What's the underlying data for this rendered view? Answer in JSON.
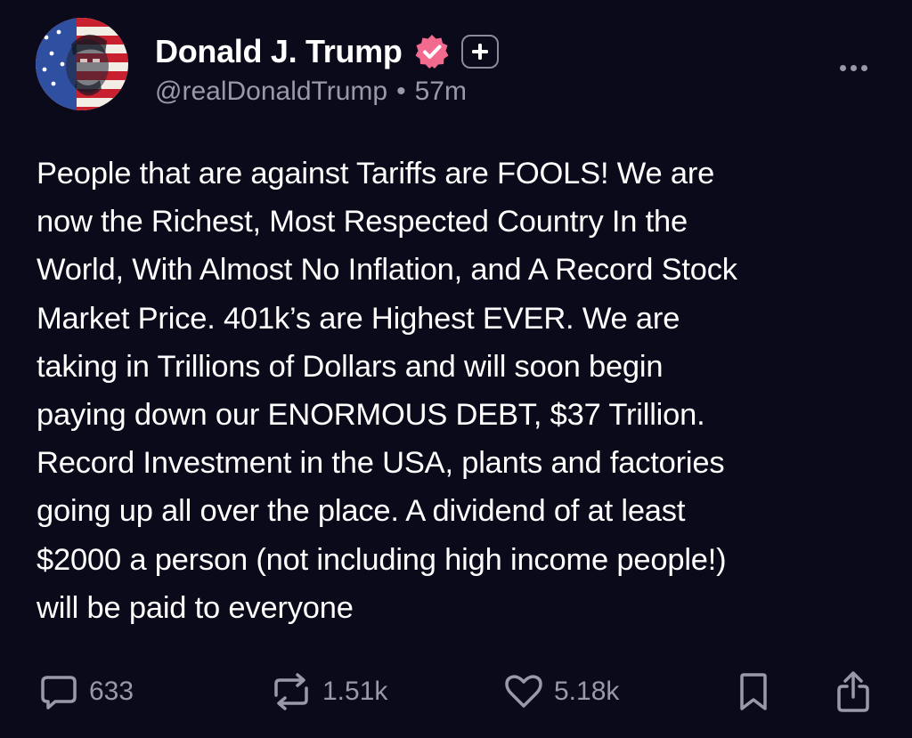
{
  "author": {
    "display_name": "Donald J. Trump",
    "handle": "@realDonaldTrump",
    "separator": "•",
    "time_ago": "57m",
    "avatar_icon": "flag-portrait-avatar",
    "verified_icon": "verified-badge-icon",
    "verified_color": "#f26a8d",
    "follow_icon": "plus-icon"
  },
  "menu_icon": "more-dots-icon",
  "post": {
    "text": "People that are against Tariffs are FOOLS! We are\nnow the Richest, Most Respected Country In the\nWorld, With Almost No Inflation, and A Record Stock\nMarket Price. 401k’s are Highest EVER. We are\ntaking in Trillions of Dollars and will soon begin\npaying down our ENORMOUS DEBT, $37 Trillion.\nRecord Investment in the USA, plants and factories\ngoing up all over the place. A dividend of at least\n$2000 a person (not including high income people!)\nwill be paid to everyone"
  },
  "actions": {
    "reply": {
      "icon": "reply-bubble-icon",
      "count": "633"
    },
    "repost": {
      "icon": "repost-icon",
      "count": "1.51k"
    },
    "like": {
      "icon": "heart-icon",
      "count": "5.18k"
    },
    "bookmark": {
      "icon": "bookmark-icon"
    },
    "share": {
      "icon": "share-icon"
    }
  },
  "colors": {
    "background": "#0b0a1a",
    "text": "#ffffff",
    "muted": "#9a99a8"
  }
}
